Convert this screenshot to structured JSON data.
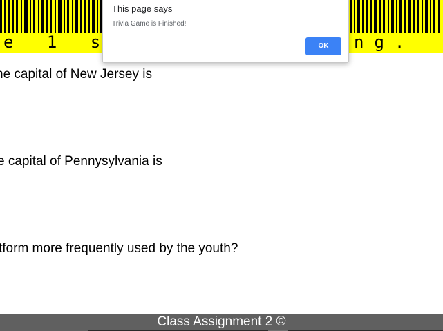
{
  "banner": {
    "text_left": "e 1 se",
    "text_right": "ng.",
    "background_color": "#ffff00",
    "barcode_icon": "barcode-image"
  },
  "questions": [
    "he capital of New Jersey is",
    "e capital of Pennysylvania is",
    "tform more frequently used by the youth?"
  ],
  "footer": {
    "text": "Class Assignment 2 ©"
  },
  "dialog": {
    "title": "This page says",
    "message": "Trivia Game is Finished!",
    "ok_label": "OK",
    "ok_color": "#3b82f6"
  }
}
